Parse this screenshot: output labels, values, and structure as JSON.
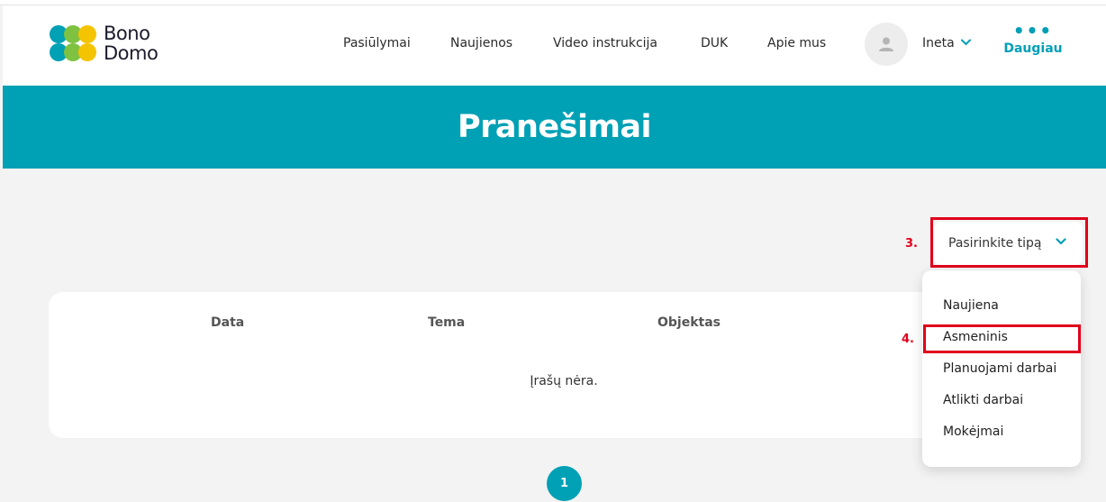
{
  "brand": {
    "line1": "Bono",
    "line2": "Domo",
    "colors": {
      "teal": "#00a0b5",
      "green": "#7fc241",
      "yellow": "#f5c400",
      "red_annotation": "#e0001b"
    }
  },
  "nav": {
    "items": [
      "Pasiūlymai",
      "Naujienos",
      "Video instrukcija",
      "DUK",
      "Apie mus"
    ]
  },
  "user": {
    "name": "Ineta",
    "avatar_icon": "user-icon",
    "chevron_icon": "chevron-down-icon"
  },
  "more": {
    "dots": "•••",
    "label": "Daugiau"
  },
  "page": {
    "title": "Pranešimai"
  },
  "filter": {
    "label": "Pasirinkite tipą",
    "chevron_icon": "chevron-down-icon",
    "options": [
      "Naujiena",
      "Asmeninis",
      "Planuojami darbai",
      "Atlikti darbai",
      "Mokėjmai"
    ]
  },
  "annotations": {
    "step3": "3.",
    "step4": "4."
  },
  "table": {
    "columns": [
      "Data",
      "Tema",
      "Objektas"
    ],
    "empty_text": "Įrašų nėra."
  },
  "pagination": {
    "current": "1"
  }
}
